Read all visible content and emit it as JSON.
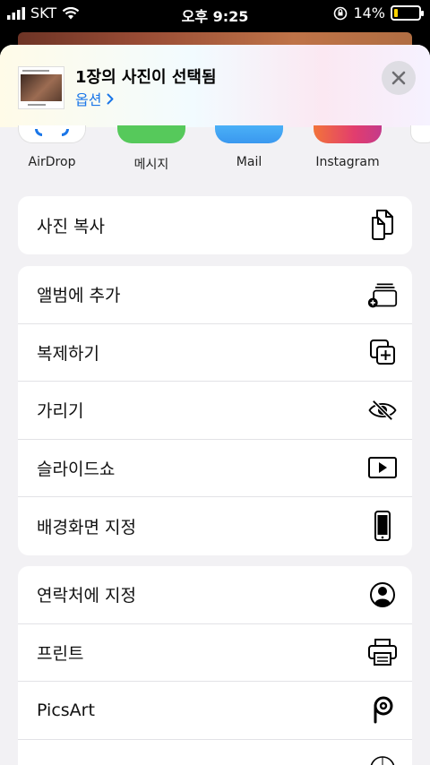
{
  "status_bar": {
    "carrier": "SKT",
    "time": "오후 9:25",
    "battery_percent": "14%",
    "battery_level": 0.14,
    "battery_color": "#ffd400"
  },
  "header": {
    "title": "1장의 사진이 선택됨",
    "options_label": "옵션 "
  },
  "apps": [
    {
      "label": "AirDrop",
      "color": "#ffffff",
      "icon": "airdrop-icon"
    },
    {
      "label": "메시지",
      "color": "#56c95b",
      "icon": "messages-icon"
    },
    {
      "label": "Mail",
      "color": "#4aa6f4",
      "icon": "mail-icon"
    },
    {
      "label": "Instagram",
      "color": "#e23d6e",
      "icon": "instagram-icon"
    }
  ],
  "groups": [
    {
      "rows": [
        {
          "label": "사진 복사",
          "icon": "copy-icon"
        }
      ]
    },
    {
      "rows": [
        {
          "label": "앨범에 추가",
          "icon": "add-album-icon"
        },
        {
          "label": "복제하기",
          "icon": "duplicate-icon"
        },
        {
          "label": "가리기",
          "icon": "hide-icon"
        },
        {
          "label": "슬라이드쇼",
          "icon": "slideshow-icon"
        },
        {
          "label": "배경화면 지정",
          "icon": "phone-icon"
        }
      ]
    },
    {
      "rows": [
        {
          "label": "연락처에 지정",
          "icon": "contact-icon"
        },
        {
          "label": "프린트",
          "icon": "printer-icon"
        },
        {
          "label": "PicsArt",
          "icon": "picsart-icon"
        }
      ]
    }
  ]
}
